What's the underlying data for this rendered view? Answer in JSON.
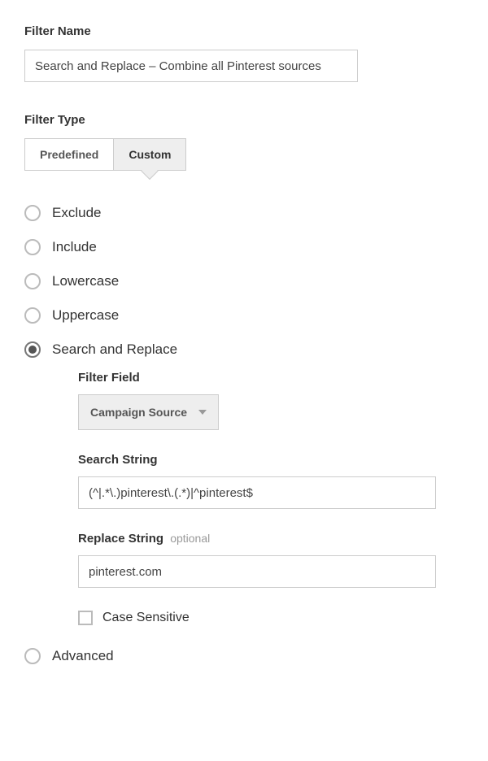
{
  "filterName": {
    "label": "Filter Name",
    "value": "Search and Replace – Combine all Pinterest sources"
  },
  "filterType": {
    "label": "Filter Type",
    "tabs": {
      "predefined": "Predefined",
      "custom": "Custom"
    }
  },
  "radios": {
    "exclude": "Exclude",
    "include": "Include",
    "lowercase": "Lowercase",
    "uppercase": "Uppercase",
    "searchReplace": "Search and Replace",
    "advanced": "Advanced"
  },
  "searchReplace": {
    "filterField": {
      "label": "Filter Field",
      "value": "Campaign Source"
    },
    "searchString": {
      "label": "Search String",
      "value": "(^|.*\\.)pinterest\\.(.*)|^pinterest$"
    },
    "replaceString": {
      "label": "Replace String",
      "optional": "optional",
      "value": "pinterest.com"
    },
    "caseSensitive": "Case Sensitive"
  }
}
